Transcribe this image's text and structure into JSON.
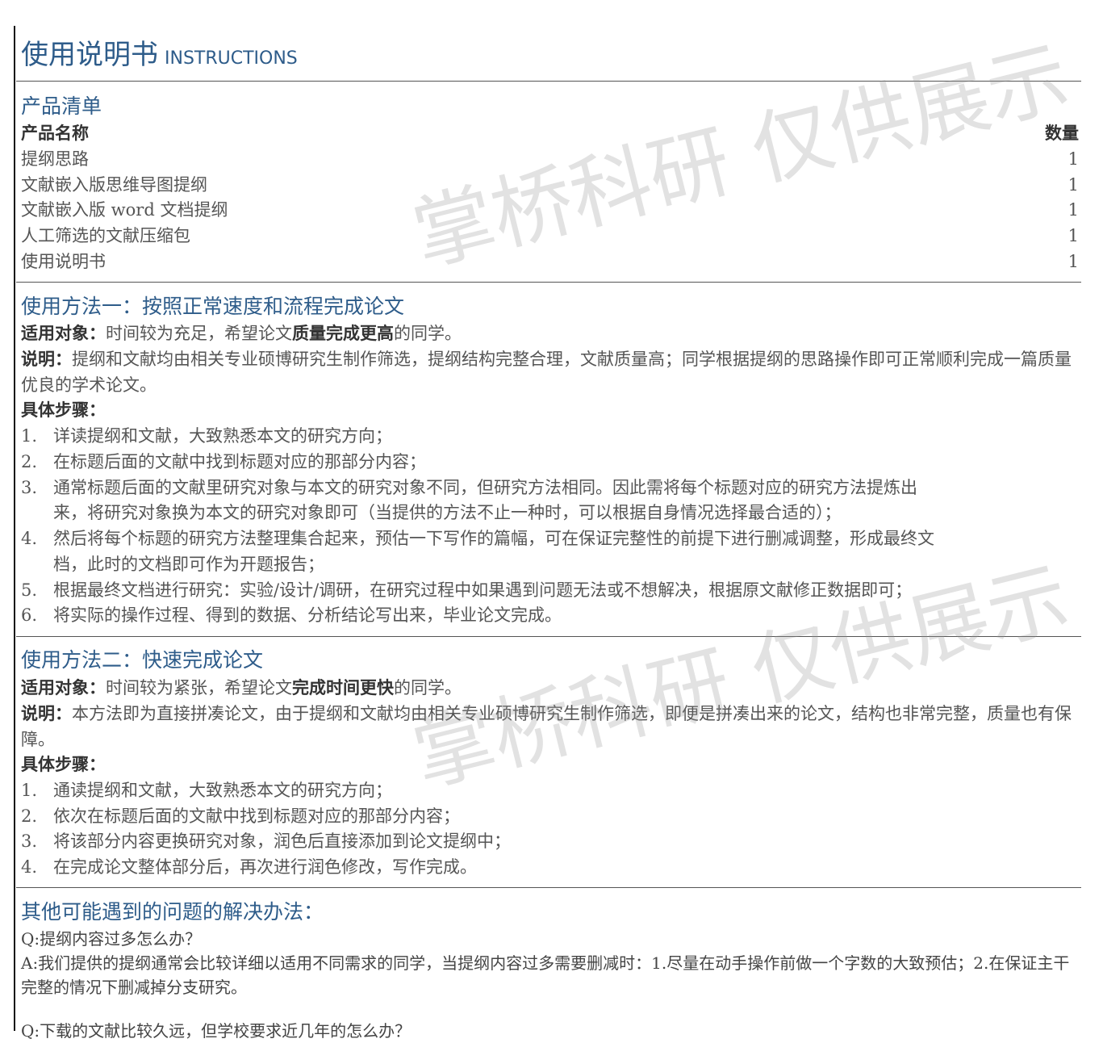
{
  "title": {
    "cn": "使用说明书",
    "en": "INSTRUCTIONS"
  },
  "product_list": {
    "heading": "产品清单",
    "col_name": "产品名称",
    "col_qty": "数量",
    "items": [
      {
        "name": "提纲思路",
        "qty": "1"
      },
      {
        "name": "文献嵌入版思维导图提纲",
        "qty": "1"
      },
      {
        "name": "文献嵌入版 word 文档提纲",
        "qty": "1"
      },
      {
        "name": "人工筛选的文献压缩包",
        "qty": "1"
      },
      {
        "name": "使用说明书",
        "qty": "1"
      }
    ]
  },
  "method1": {
    "heading": "使用方法一：按照正常速度和流程完成论文",
    "target_label": "适用对象：",
    "target_pre": "时间较为充足，希望论文",
    "target_bold": "质量完成更高",
    "target_post": "的同学。",
    "desc_label": "说明：",
    "desc_text": "提纲和文献均由相关专业硕博研究生制作筛选，提纲结构完整合理，文献质量高；同学根据提纲的思路操作即可正常顺利完成一篇质量优良的学术论文。",
    "steps_label": "具体步骤：",
    "steps": [
      {
        "num": "1.",
        "lines": [
          "详读提纲和文献，大致熟悉本文的研究方向；"
        ]
      },
      {
        "num": "2.",
        "lines": [
          "在标题后面的文献中找到标题对应的那部分内容；"
        ]
      },
      {
        "num": "3.",
        "lines": [
          "通常标题后面的文献里研究对象与本文的研究对象不同，但研究方法相同。因此需将每个标题对应的研究方法提炼出",
          "来，将研究对象换为本文的研究对象即可（当提供的方法不止一种时，可以根据自身情况选择最合适的）；"
        ]
      },
      {
        "num": "4.",
        "lines": [
          "然后将每个标题的研究方法整理集合起来，预估一下写作的篇幅，可在保证完整性的前提下进行删减调整，形成最终文",
          "档，此时的文档即可作为开题报告；"
        ]
      },
      {
        "num": "5.",
        "lines": [
          "根据最终文档进行研究：实验/设计/调研，在研究过程中如果遇到问题无法或不想解决，根据原文献修正数据即可；"
        ]
      },
      {
        "num": "6.",
        "lines": [
          "将实际的操作过程、得到的数据、分析结论写出来，毕业论文完成。"
        ]
      }
    ]
  },
  "method2": {
    "heading": "使用方法二：快速完成论文",
    "target_label": "适用对象：",
    "target_pre": "时间较为紧张，希望论文",
    "target_bold": "完成时间更快",
    "target_post": "的同学。",
    "desc_label": "说明：",
    "desc_text": "本方法即为直接拼凑论文，由于提纲和文献均由相关专业硕博研究生制作筛选，即便是拼凑出来的论文，结构也非常完整，质量也有保障。",
    "steps_label": "具体步骤：",
    "steps": [
      {
        "num": "1.",
        "text": "通读提纲和文献，大致熟悉本文的研究方向；"
      },
      {
        "num": "2.",
        "text": "依次在标题后面的文献中找到标题对应的那部分内容；"
      },
      {
        "num": "3.",
        "text": "将该部分内容更换研究对象，润色后直接添加到论文提纲中；"
      },
      {
        "num": "4.",
        "text": "在完成论文整体部分后，再次进行润色修改，写作完成。"
      }
    ]
  },
  "faq": {
    "heading": "其他可能遇到的问题的解决办法：",
    "q1": "Q:提纲内容过多怎么办？",
    "a1": "A:我们提供的提纲通常会比较详细以适用不同需求的同学，当提纲内容过多需要删减时：1.尽量在动手操作前做一个字数的大致预估；2.在保证主干完整的情况下删减掉分支研究。",
    "q2": "Q:下载的文献比较久远，但学校要求近几年的怎么办？"
  },
  "watermarks": [
    "掌桥科研 仅供展示",
    "掌桥科研 仅供展示"
  ]
}
